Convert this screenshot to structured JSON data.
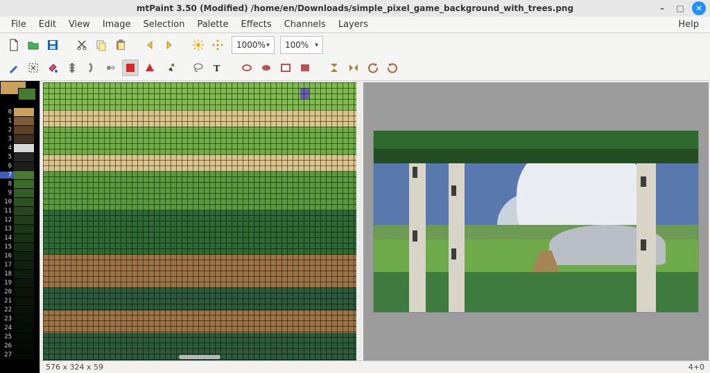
{
  "window": {
    "title": "mtPaint 3.50 (Modified) /home/en/Downloads/simple_pixel_game_background_with_trees.png",
    "min_tip": "–",
    "max_tip": "□",
    "close_tip": "✕"
  },
  "menu": {
    "file": "File",
    "edit": "Edit",
    "view": "View",
    "image": "Image",
    "selection": "Selection",
    "palette": "Palette",
    "effects": "Effects",
    "channels": "Channels",
    "layers": "Layers",
    "help": "Help"
  },
  "toolbar": {
    "zoom_main": "1000%",
    "zoom_secondary": "100%"
  },
  "palette": {
    "fg_color": "#c9a25c",
    "bg_color": "#4a7a2f",
    "entries": [
      {
        "i": "0",
        "c": "#c9a25c"
      },
      {
        "i": "1",
        "c": "#7a5a38"
      },
      {
        "i": "2",
        "c": "#5c4028"
      },
      {
        "i": "3",
        "c": "#403020"
      },
      {
        "i": "4",
        "c": "#d8d8d8"
      },
      {
        "i": "5",
        "c": "#262626"
      },
      {
        "i": "6",
        "c": "#1e1e1e"
      },
      {
        "i": "7",
        "c": "#4a7a2f"
      },
      {
        "i": "8",
        "c": "#3c6a2a"
      },
      {
        "i": "9",
        "c": "#345e26"
      },
      {
        "i": "10",
        "c": "#2d5222"
      },
      {
        "i": "11",
        "c": "#27481e"
      },
      {
        "i": "12",
        "c": "#213e1a"
      },
      {
        "i": "13",
        "c": "#1c3617"
      },
      {
        "i": "14",
        "c": "#183014"
      },
      {
        "i": "15",
        "c": "#142a11"
      },
      {
        "i": "16",
        "c": "#11240f"
      },
      {
        "i": "17",
        "c": "#0f200d"
      },
      {
        "i": "18",
        "c": "#0d1c0c"
      },
      {
        "i": "19",
        "c": "#0b180a"
      },
      {
        "i": "20",
        "c": "#0a1509"
      },
      {
        "i": "21",
        "c": "#091308"
      },
      {
        "i": "22",
        "c": "#081107"
      },
      {
        "i": "23",
        "c": "#070f06"
      },
      {
        "i": "24",
        "c": "#060d06"
      },
      {
        "i": "25",
        "c": "#050b05"
      },
      {
        "i": "26",
        "c": "#050a05"
      },
      {
        "i": "27",
        "c": "#040904"
      }
    ],
    "selected_index": "7"
  },
  "status": {
    "dims": "576 x 324 x 59",
    "right": "4+0"
  }
}
